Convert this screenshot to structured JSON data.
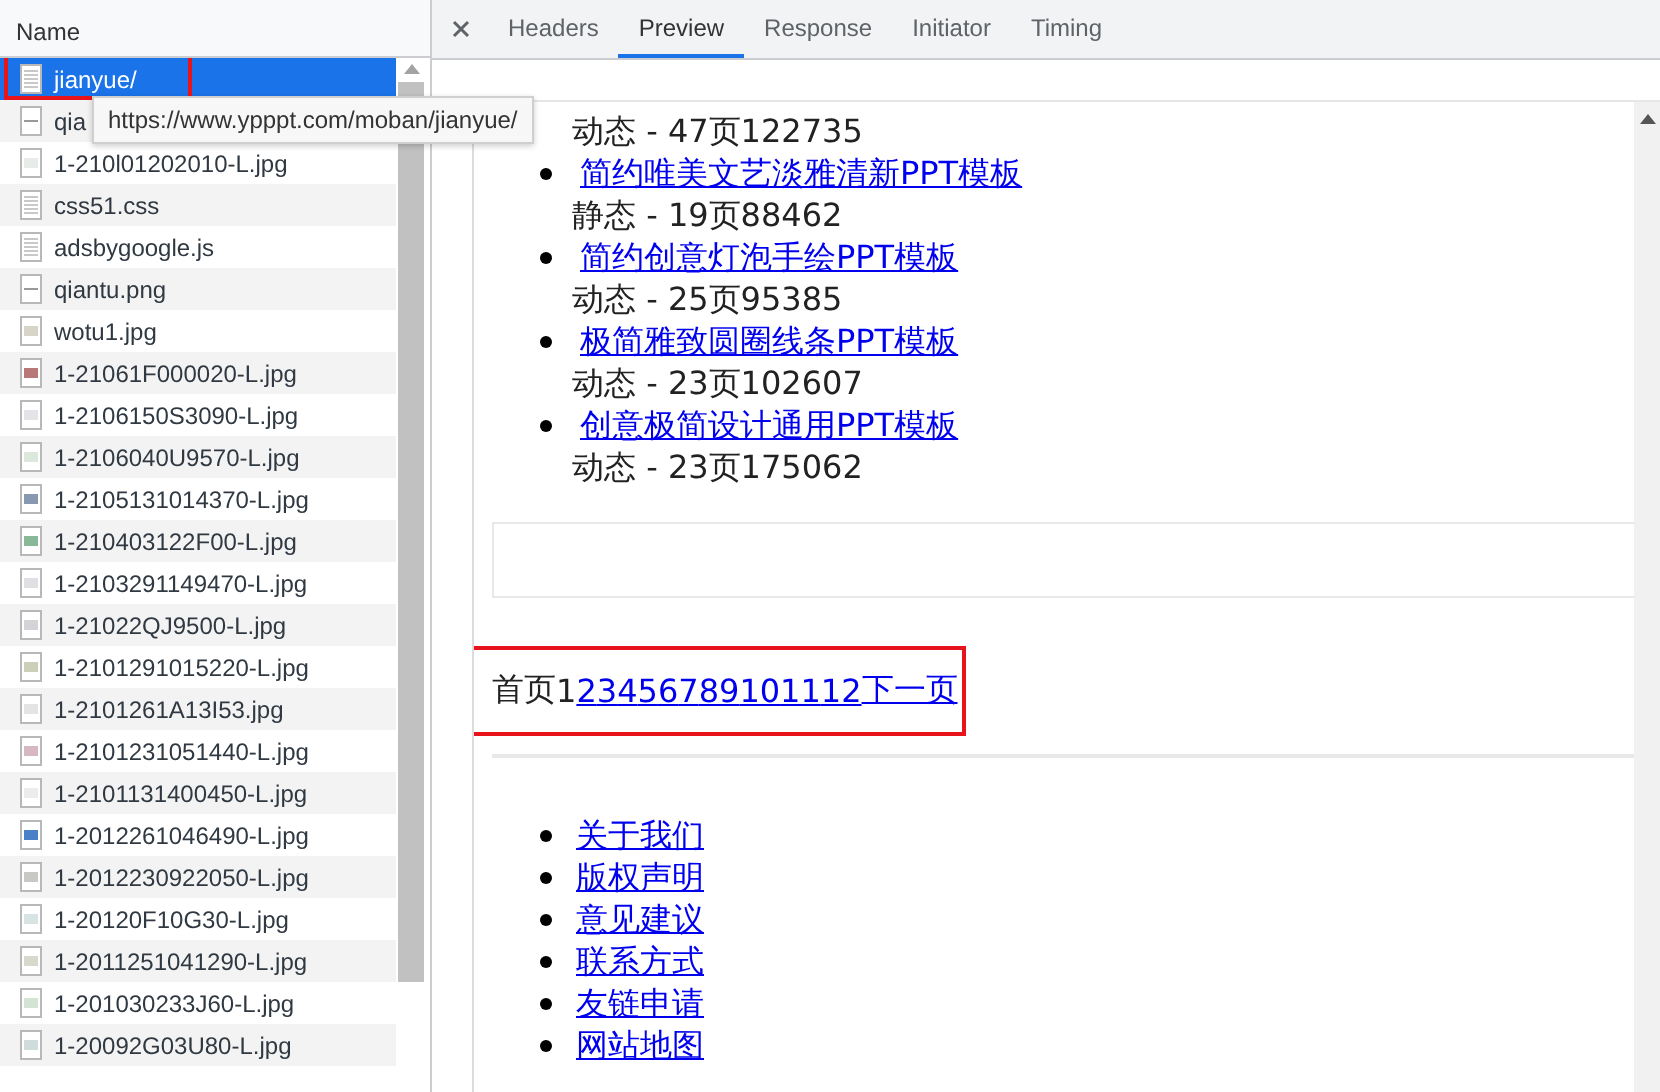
{
  "requests": {
    "column": "Name",
    "items": [
      {
        "name": "jianyue/",
        "kind": "document",
        "selected": true,
        "highlighted": true
      },
      {
        "name": "qia",
        "kind": "blank",
        "selected": false,
        "highlighted": false
      },
      {
        "name": "1-210l01202010-L.jpg",
        "kind": "image",
        "color": "#e8ece8",
        "selected": false,
        "highlighted": false
      },
      {
        "name": "css51.css",
        "kind": "document",
        "selected": false,
        "highlighted": false
      },
      {
        "name": "adsbygoogle.js",
        "kind": "document",
        "selected": false,
        "highlighted": false
      },
      {
        "name": "qiantu.png",
        "kind": "blank",
        "selected": false,
        "highlighted": false
      },
      {
        "name": "wotu1.jpg",
        "kind": "image",
        "color": "#d8d4c8",
        "selected": false,
        "highlighted": false
      },
      {
        "name": "1-21061F000020-L.jpg",
        "kind": "image",
        "color": "#b87878",
        "selected": false,
        "highlighted": false
      },
      {
        "name": "1-2106150S3090-L.jpg",
        "kind": "image",
        "color": "#e4e4e8",
        "selected": false,
        "highlighted": false
      },
      {
        "name": "1-2106040U9570-L.jpg",
        "kind": "image",
        "color": "#dce8dc",
        "selected": false,
        "highlighted": false
      },
      {
        "name": "1-2105131014370-L.jpg",
        "kind": "image",
        "color": "#8898b0",
        "selected": false,
        "highlighted": false
      },
      {
        "name": "1-210403122F00-L.jpg",
        "kind": "image",
        "color": "#88b898",
        "selected": false,
        "highlighted": false
      },
      {
        "name": "1-2103291149470-L.jpg",
        "kind": "image",
        "color": "#e0e0e4",
        "selected": false,
        "highlighted": false
      },
      {
        "name": "1-21022QJ9500-L.jpg",
        "kind": "image",
        "color": "#d4d4d8",
        "selected": false,
        "highlighted": false
      },
      {
        "name": "1-2101291015220-L.jpg",
        "kind": "image",
        "color": "#ccd0b8",
        "selected": false,
        "highlighted": false
      },
      {
        "name": "1-2101261A13I53.jpg",
        "kind": "image",
        "color": "#e4e4e4",
        "selected": false,
        "highlighted": false
      },
      {
        "name": "1-2101231051440-L.jpg",
        "kind": "image",
        "color": "#d8b8c0",
        "selected": false,
        "highlighted": false
      },
      {
        "name": "1-2101131400450-L.jpg",
        "kind": "image",
        "color": "#ececec",
        "selected": false,
        "highlighted": false
      },
      {
        "name": "1-2012261046490-L.jpg",
        "kind": "image",
        "color": "#4a80c8",
        "selected": false,
        "highlighted": false
      },
      {
        "name": "1-2012230922050-L.jpg",
        "kind": "image",
        "color": "#c8c8c4",
        "selected": false,
        "highlighted": false
      },
      {
        "name": "1-20120F10G30-L.jpg",
        "kind": "image",
        "color": "#d8e4e4",
        "selected": false,
        "highlighted": false
      },
      {
        "name": "1-2011251041290-L.jpg",
        "kind": "image",
        "color": "#d8d8cc",
        "selected": false,
        "highlighted": false
      },
      {
        "name": "1-201030233J60-L.jpg",
        "kind": "image",
        "color": "#d4e4d4",
        "selected": false,
        "highlighted": false
      },
      {
        "name": "1-20092G03U80-L.jpg",
        "kind": "image",
        "color": "#d0dcdc",
        "selected": false,
        "highlighted": false
      }
    ]
  },
  "tooltip": "https://www.ypppt.com/moban/jianyue/",
  "tabs": [
    {
      "label": "Headers",
      "selected": false
    },
    {
      "label": "Preview",
      "selected": true
    },
    {
      "label": "Response",
      "selected": false
    },
    {
      "label": "Initiator",
      "selected": false
    },
    {
      "label": "Timing",
      "selected": false
    }
  ],
  "preview": {
    "first_meta": "动态 - 47页122735",
    "templates": [
      {
        "title": "简约唯美文艺淡雅清新PPT模板",
        "meta": "静态 - 19页88462"
      },
      {
        "title": "简约创意灯泡手绘PPT模板",
        "meta": "动态 - 25页95385"
      },
      {
        "title": "极简雅致圆圈线条PPT模板",
        "meta": "动态 - 23页102607"
      },
      {
        "title": "创意极简设计通用PPT模板",
        "meta": "动态 - 23页175062"
      }
    ],
    "pagination": {
      "highlighted": true,
      "label": "首页",
      "current": "1",
      "links": [
        "2",
        "3",
        "4",
        "5",
        "6",
        "7",
        "8",
        "9",
        "10",
        "11",
        "12",
        "下一页"
      ]
    },
    "footer_links": [
      "关于我们",
      "版权声明",
      "意见建议",
      "联系方式",
      "友链申请",
      "网站地图"
    ]
  }
}
